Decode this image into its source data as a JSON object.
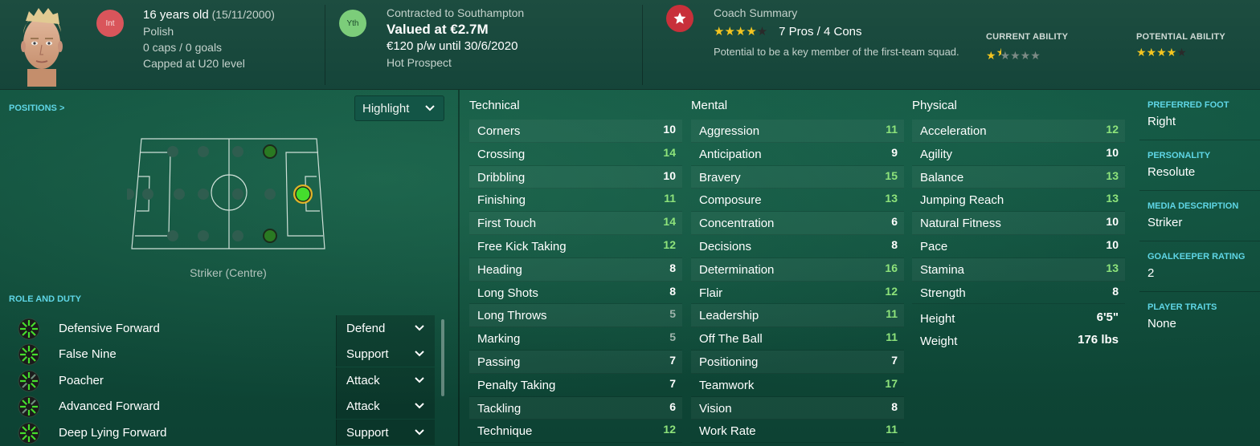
{
  "header": {
    "badges": {
      "international": "Int",
      "youth": "Yth"
    },
    "age": "16 years old",
    "dob": "(15/11/2000)",
    "nationality": "Polish",
    "caps": "0 caps / 0 goals",
    "capped_level": "Capped at U20 level",
    "contract": "Contracted to Southampton",
    "value": "Valued at €2.7M",
    "wage": "€120 p/w until 30/6/2020",
    "prospect": "Hot Prospect",
    "coach_summary_title": "Coach Summary",
    "coach_summary_rating": 4,
    "pros_cons": "7 Pros / 4 Cons",
    "coach_summary_text": "Potential to be a key member of the first-team squad.",
    "current_ability_label": "CURRENT ABILITY",
    "current_ability_stars": 1.5,
    "potential_ability_label": "POTENTIAL ABILITY",
    "potential_ability_stars": 4
  },
  "left": {
    "positions_label": "POSITIONS >",
    "highlight_button": "Highlight",
    "position_caption": "Striker (Centre)",
    "role_duty_label": "ROLE AND DUTY",
    "roles": [
      {
        "name": "Defensive Forward",
        "duty": "Defend"
      },
      {
        "name": "False Nine",
        "duty": "Support"
      },
      {
        "name": "Poacher",
        "duty": "Attack"
      },
      {
        "name": "Advanced Forward",
        "duty": "Attack"
      },
      {
        "name": "Deep Lying Forward",
        "duty": "Support"
      }
    ]
  },
  "attributes": {
    "technical_title": "Technical",
    "mental_title": "Mental",
    "physical_title": "Physical",
    "technical": [
      {
        "name": "Corners",
        "value": "10"
      },
      {
        "name": "Crossing",
        "value": "14"
      },
      {
        "name": "Dribbling",
        "value": "10"
      },
      {
        "name": "Finishing",
        "value": "11"
      },
      {
        "name": "First Touch",
        "value": "14"
      },
      {
        "name": "Free Kick Taking",
        "value": "12"
      },
      {
        "name": "Heading",
        "value": "8"
      },
      {
        "name": "Long Shots",
        "value": "8"
      },
      {
        "name": "Long Throws",
        "value": "5"
      },
      {
        "name": "Marking",
        "value": "5"
      },
      {
        "name": "Passing",
        "value": "7"
      },
      {
        "name": "Penalty Taking",
        "value": "7"
      },
      {
        "name": "Tackling",
        "value": "6"
      },
      {
        "name": "Technique",
        "value": "12"
      }
    ],
    "mental": [
      {
        "name": "Aggression",
        "value": "11"
      },
      {
        "name": "Anticipation",
        "value": "9"
      },
      {
        "name": "Bravery",
        "value": "15"
      },
      {
        "name": "Composure",
        "value": "13"
      },
      {
        "name": "Concentration",
        "value": "6"
      },
      {
        "name": "Decisions",
        "value": "8"
      },
      {
        "name": "Determination",
        "value": "16"
      },
      {
        "name": "Flair",
        "value": "12"
      },
      {
        "name": "Leadership",
        "value": "11"
      },
      {
        "name": "Off The Ball",
        "value": "11"
      },
      {
        "name": "Positioning",
        "value": "7"
      },
      {
        "name": "Teamwork",
        "value": "17"
      },
      {
        "name": "Vision",
        "value": "8"
      },
      {
        "name": "Work Rate",
        "value": "11"
      }
    ],
    "physical": [
      {
        "name": "Acceleration",
        "value": "12"
      },
      {
        "name": "Agility",
        "value": "10"
      },
      {
        "name": "Balance",
        "value": "13"
      },
      {
        "name": "Jumping Reach",
        "value": "13"
      },
      {
        "name": "Natural Fitness",
        "value": "10"
      },
      {
        "name": "Pace",
        "value": "10"
      },
      {
        "name": "Stamina",
        "value": "13"
      },
      {
        "name": "Strength",
        "value": "8"
      }
    ],
    "height_label": "Height",
    "height_value": "6'5\"",
    "weight_label": "Weight",
    "weight_value": "176 lbs"
  },
  "info": {
    "preferred_foot_label": "PREFERRED FOOT",
    "preferred_foot": "Right",
    "personality_label": "PERSONALITY",
    "personality": "Resolute",
    "media_label": "MEDIA DESCRIPTION",
    "media": "Striker",
    "gk_label": "GOALKEEPER RATING",
    "gk": "2",
    "traits_label": "PLAYER TRAITS",
    "traits": "None"
  },
  "colors": {
    "accent": "#5fd6e6",
    "good_value": "#8ee37b",
    "low_value": "#9fb4ac",
    "star": "#f4c520"
  }
}
